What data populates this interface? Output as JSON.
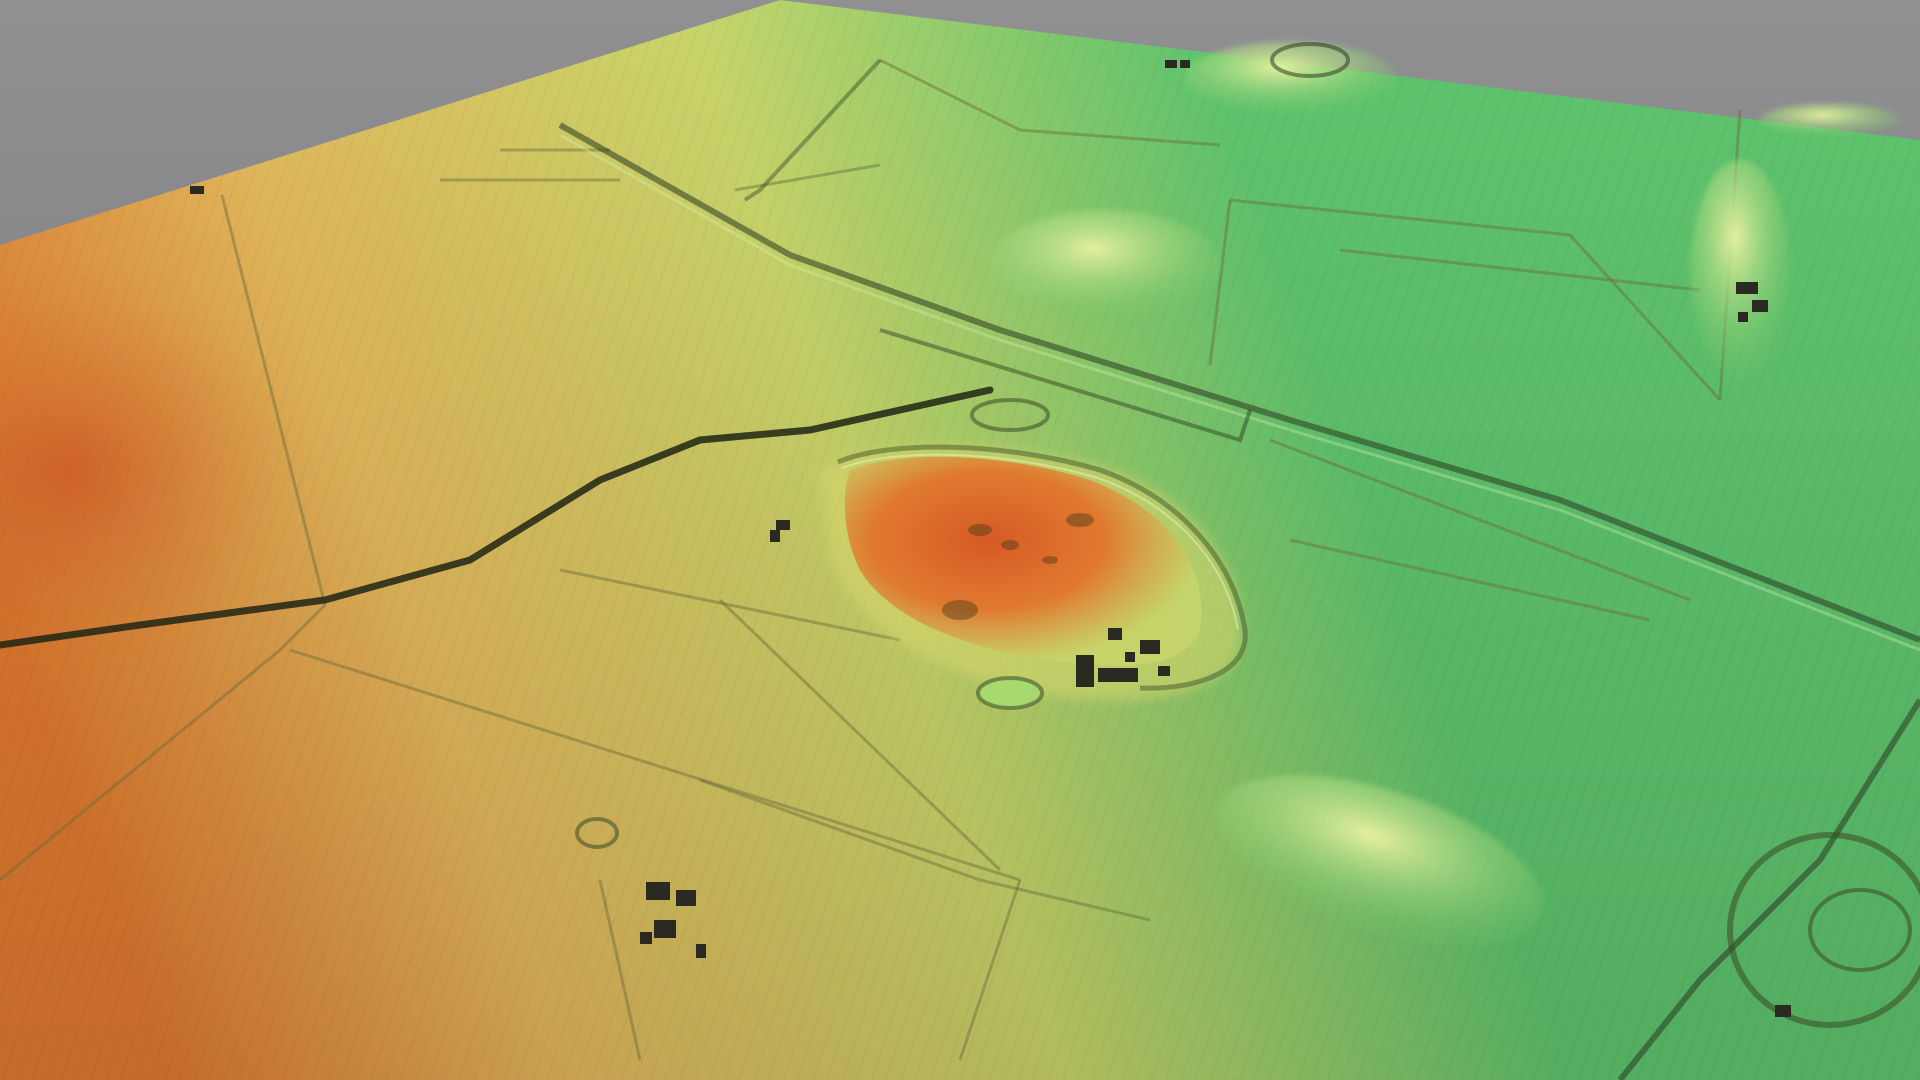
{
  "view": {
    "type": "3D shaded terrain elevation model (LiDAR-style)",
    "background_color": "#8a8a8c",
    "colors": {
      "low_elevation": "#5fc46e",
      "mid_elevation": "#c8d56a",
      "upper_elevation": "#e3b85c",
      "high_elevation": "#e07a30",
      "peak": "#d65a25",
      "structures": "#2a2a22"
    },
    "elevation_scale": [
      "low",
      "mid",
      "upper",
      "high",
      "peak"
    ],
    "features": [
      "central-hill",
      "enclosure-earthwork",
      "field-boundaries",
      "roads",
      "ditch",
      "farm-buildings",
      "ring-earthwork",
      "round-barrows",
      "water-pond"
    ]
  }
}
